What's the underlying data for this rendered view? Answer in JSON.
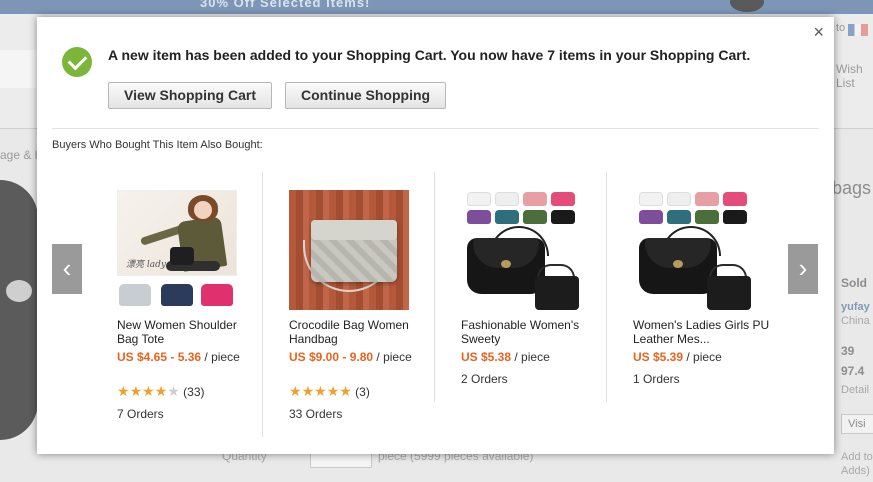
{
  "background": {
    "banner_text": "30% Off  Selected Items!",
    "lang_text": "to",
    "wish_text": "Wish List",
    "breadcrumb": "age & l",
    "right_title": "bags",
    "sold_label": "Sold",
    "seller_name": "yufay",
    "seller_country": "China",
    "stat1": "39",
    "stat2": "97.4",
    "detail_label": "Detail",
    "visit_label": "Visi",
    "addto_label": "Add to Adds)",
    "qty_label": "Quantity",
    "qty_note": "piece (5999 pieces available)"
  },
  "modal": {
    "close_symbol": "×",
    "message": "A new item has been added to your Shopping Cart. You now have 7 items in your Shopping Cart.",
    "view_cart_label": "View Shopping Cart",
    "continue_label": "Continue Shopping",
    "also_bought_title": "Buyers Who Bought This Item Also Bought:",
    "prev_arrow": "‹",
    "next_arrow": "›"
  },
  "products": [
    {
      "title": "New Women Shoulder Bag Tote",
      "price": "US $4.65 - 5.36",
      "unit": " / piece",
      "rating_stars": 4,
      "rating_count": "(33)",
      "orders": "7 Orders",
      "signature": "漂亮 lady"
    },
    {
      "title": "Crocodile Bag Women Handbag",
      "price": "US $9.00 - 9.80",
      "unit": " / piece",
      "rating_stars": 5,
      "rating_count": "(3)",
      "orders": "33 Orders"
    },
    {
      "title": "Fashionable Women's Sweety",
      "price": "US $5.38",
      "unit": " / piece",
      "orders": "2 Orders"
    },
    {
      "title": "Women's Ladies Girls PU Leather Mes...",
      "price": "US $5.39",
      "unit": " / piece",
      "orders": "1 Orders"
    }
  ],
  "colors": {
    "success_green": "#7bb63a",
    "price_orange": "#e9631e",
    "star_gold": "#f1a02c",
    "arrow_gray": "#9a9a9a",
    "swatches": [
      "#f2f2f2",
      "#eeeeee",
      "#e6a0a4",
      "#e44d7a",
      "#7d4f9a",
      "#2f6f7c",
      "#4a6f3a",
      "#1a1a1a"
    ]
  },
  "icons": {
    "success": "check-circle-icon",
    "close": "close-icon",
    "prev": "chevron-left-icon",
    "next": "chevron-right-icon",
    "star": "star-icon"
  }
}
